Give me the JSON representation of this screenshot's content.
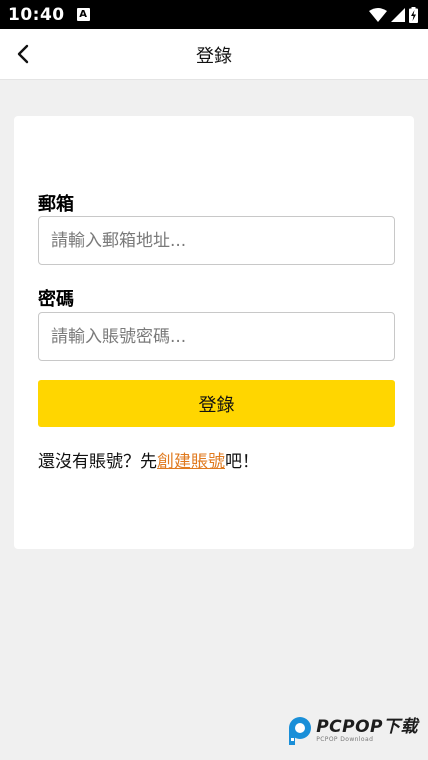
{
  "status_bar": {
    "time": "10:40",
    "notification_icon": "A"
  },
  "app_bar": {
    "title": "登錄",
    "back_icon": "chevron-left-icon"
  },
  "form": {
    "email_label": "郵箱",
    "email_placeholder": "請輸入郵箱地址...",
    "email_value": "",
    "password_label": "密碼",
    "password_placeholder": "請輸入賬號密碼...",
    "password_value": "",
    "submit_label": "登錄",
    "signup_prefix": "還沒有賬號？先",
    "signup_link": "創建賬號",
    "signup_suffix": "吧！"
  },
  "watermark": {
    "brand": "PCPOP下载",
    "sub": "PCPOP Download"
  },
  "colors": {
    "accent": "#ffd600",
    "link": "#e07a1f",
    "background": "#f0f0f0"
  }
}
